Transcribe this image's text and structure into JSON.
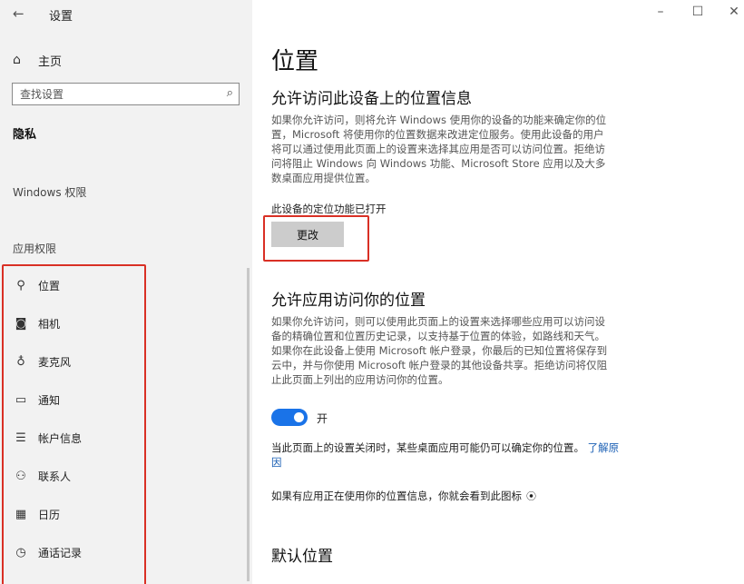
{
  "sidebar": {
    "back_icon": "back-arrow-icon",
    "app_title": "设置",
    "home_label": "主页",
    "search_placeholder": "查找设置",
    "privacy_heading": "隐私",
    "windows_permissions_heading": "Windows 权限",
    "app_permissions_heading": "应用权限",
    "items": [
      {
        "label": "位置",
        "icon": "location-icon"
      },
      {
        "label": "相机",
        "icon": "camera-icon"
      },
      {
        "label": "麦克风",
        "icon": "microphone-icon"
      },
      {
        "label": "通知",
        "icon": "notification-icon"
      },
      {
        "label": "帐户信息",
        "icon": "account-info-icon"
      },
      {
        "label": "联系人",
        "icon": "contacts-icon"
      },
      {
        "label": "日历",
        "icon": "calendar-icon"
      },
      {
        "label": "通话记录",
        "icon": "call-history-icon"
      }
    ]
  },
  "window": {
    "minimize_icon": "minimize-icon",
    "maximize_icon": "maximize-icon",
    "close_icon": "close-icon"
  },
  "main": {
    "page_title": "位置",
    "device_section": {
      "heading": "允许访问此设备上的位置信息",
      "description": "如果你允许访问，则将允许 Windows 使用你的设备的功能来确定你的位置，Microsoft 将使用你的位置数据来改进定位服务。使用此设备的用户将可以通过使用此页面上的设置来选择其应用是否可以访问位置。拒绝访问将阻止 Windows 向 Windows 功能、Microsoft Store 应用以及大多数桌面应用提供位置。",
      "status": "此设备的定位功能已打开",
      "change_button": "更改"
    },
    "app_section": {
      "heading": "允许应用访问你的位置",
      "description": "如果你允许访问，则可以使用此页面上的设置来选择哪些应用可以访问设备的精确位置和位置历史记录，以支持基于位置的体验，如路线和天气。如果你在此设备上使用 Microsoft 帐户登录，你最后的已知位置将保存到云中，并与你使用 Microsoft 帐户登录的其他设备共享。拒绝访问将仅阻止此页面上列出的应用访问你的位置。",
      "toggle_state": "开",
      "toggle_on": true,
      "note": "当此页面上的设置关闭时，某些桌面应用可能仍可以确定你的位置。",
      "learn_more": "了解原因",
      "icon_note": "如果有应用正在使用你的位置信息，你就会看到此图标",
      "location_in_use_icon": "location-in-use-icon"
    },
    "default_location_heading": "默认位置",
    "accent_color": "#1a73e8",
    "highlight_color": "#d93025"
  }
}
